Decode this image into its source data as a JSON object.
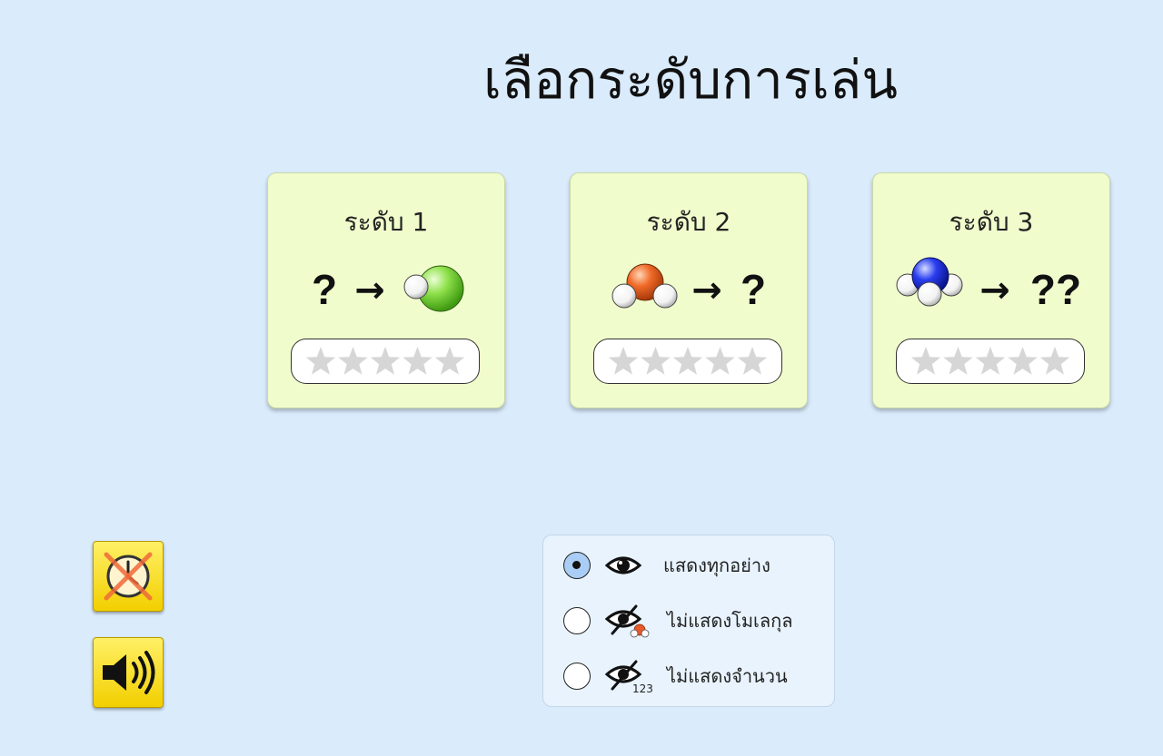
{
  "title": "เลือกระดับการเล่น",
  "colors": {
    "background": "#daebfb",
    "card": "#f0fccc",
    "star_empty": "#d6d6d6",
    "button_yellow": "#f7dd1a",
    "radio_selected": "#a9cdf4"
  },
  "levels": [
    {
      "label": "ระดับ 1",
      "question_left": "?",
      "arrow": "→",
      "question_right": "",
      "icon": "hcl-molecule-icon",
      "stars_earned": 0,
      "stars_total": 5
    },
    {
      "label": "ระดับ 2",
      "question_left": "",
      "arrow": "→",
      "question_right": "?",
      "icon": "water-molecule-icon",
      "stars_earned": 0,
      "stars_total": 5
    },
    {
      "label": "ระดับ 3",
      "question_left": "",
      "arrow": "→",
      "question_right": "??",
      "icon": "ammonia-molecule-icon",
      "stars_earned": 0,
      "stars_total": 5
    }
  ],
  "side_buttons": {
    "timer": {
      "icon": "timer-off-icon"
    },
    "sound": {
      "icon": "speaker-on-icon"
    }
  },
  "display_options": [
    {
      "label": "แสดงทุกอย่าง",
      "icon": "eye-icon",
      "selected": true
    },
    {
      "label": "ไม่แสดงโมเลกุล",
      "icon": "eye-hidden-molecule-icon",
      "selected": false
    },
    {
      "label": "ไม่แสดงจำนวน",
      "icon": "eye-hidden-number-icon",
      "icon_text": "123",
      "selected": false
    }
  ]
}
